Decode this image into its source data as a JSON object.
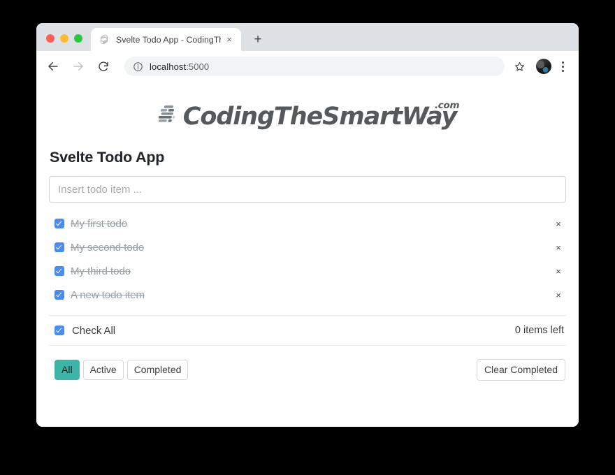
{
  "browser": {
    "traffic_lights": [
      {
        "name": "close",
        "color": "#ff5f57"
      },
      {
        "name": "minimize",
        "color": "#febc2e"
      },
      {
        "name": "zoom",
        "color": "#28c840"
      }
    ],
    "tab": {
      "title": "Svelte Todo App - CodingTheS",
      "favicon": "svelte-logo-icon",
      "close_label": "×"
    },
    "new_tab_label": "+",
    "toolbar": {
      "back_icon": "arrow-left-icon",
      "forward_icon": "arrow-right-icon",
      "reload_icon": "reload-icon",
      "site_info_icon": "info-circle-icon",
      "url_host": "localhost",
      "url_port": ":5000",
      "bookmark_icon": "star-icon",
      "avatar_icon": "profile-avatar",
      "menu_icon": "three-dot-menu-icon"
    }
  },
  "page": {
    "logo": {
      "mark": "speed-lines-icon",
      "wordmark": "CodingTheSmartWay",
      "tld": ".com"
    },
    "app_title": "Svelte Todo App",
    "new_todo": {
      "placeholder": "Insert todo item ...",
      "value": ""
    },
    "todos": [
      {
        "label": "My first todo",
        "completed": true,
        "delete_label": "×"
      },
      {
        "label": "My second todo",
        "completed": true,
        "delete_label": "×"
      },
      {
        "label": "My third todo",
        "completed": true,
        "delete_label": "×"
      },
      {
        "label": "A new todo item",
        "completed": true,
        "delete_label": "×"
      }
    ],
    "check_all": {
      "label": "Check All",
      "checked": true
    },
    "items_left": "0 items left",
    "filters": [
      {
        "label": "All",
        "active": true
      },
      {
        "label": "Active",
        "active": false
      },
      {
        "label": "Completed",
        "active": false
      }
    ],
    "clear_completed_label": "Clear Completed",
    "colors": {
      "accent_teal": "#3ab5a8",
      "checkbox_blue": "#4a8cf7",
      "completed_text": "#9aa0a6"
    }
  }
}
